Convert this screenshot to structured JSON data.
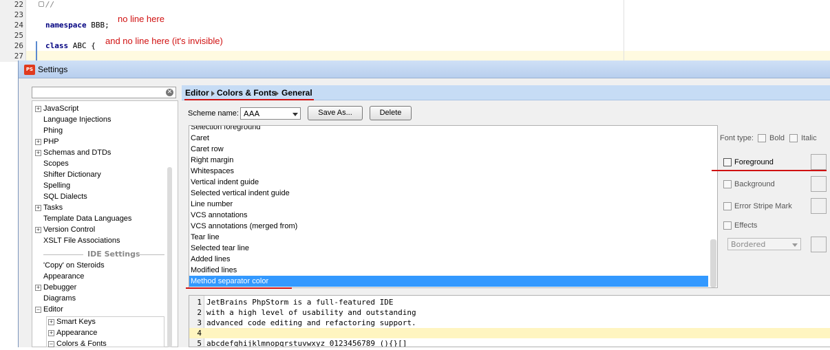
{
  "editor": {
    "line_numbers": [
      "22",
      "23",
      "24",
      "25",
      "26",
      "27"
    ],
    "line_comment": "//",
    "line_namespace_kw": "namespace",
    "line_namespace_rest": " BBB;",
    "line_class_kw": "class",
    "line_class_rest": " ABC {"
  },
  "annotations": {
    "note1": "no line here",
    "note2": "and no line here (it's invisible)"
  },
  "dialog": {
    "title": "Settings",
    "app_icon_text": "PS"
  },
  "search": {
    "value": "",
    "clear_glyph": "✕"
  },
  "tree": {
    "items": [
      {
        "label": "JavaScript",
        "expandable": true,
        "glyph": "+"
      },
      {
        "label": "Language Injections",
        "expandable": false
      },
      {
        "label": "Phing",
        "expandable": false
      },
      {
        "label": "PHP",
        "expandable": true,
        "glyph": "+"
      },
      {
        "label": "Schemas and DTDs",
        "expandable": true,
        "glyph": "+"
      },
      {
        "label": "Scopes",
        "expandable": false
      },
      {
        "label": "Shifter Dictionary",
        "expandable": false
      },
      {
        "label": "Spelling",
        "expandable": false
      },
      {
        "label": "SQL Dialects",
        "expandable": false
      },
      {
        "label": "Tasks",
        "expandable": true,
        "glyph": "+"
      },
      {
        "label": "Template Data Languages",
        "expandable": false
      },
      {
        "label": "Version Control",
        "expandable": true,
        "glyph": "+"
      },
      {
        "label": "XSLT File Associations",
        "expandable": false
      }
    ],
    "section_ide": "IDE Settings",
    "ide_items": [
      {
        "label": "'Copy' on Steroids",
        "expandable": false
      },
      {
        "label": "Appearance",
        "expandable": false
      },
      {
        "label": "Debugger",
        "expandable": true,
        "glyph": "+"
      },
      {
        "label": "Diagrams",
        "expandable": false
      },
      {
        "label": "Editor",
        "expandable": true,
        "glyph": "−"
      }
    ],
    "editor_children": [
      {
        "label": "Smart Keys",
        "glyph": "+"
      },
      {
        "label": "Appearance",
        "glyph": "+"
      },
      {
        "label": "Colors & Fonts",
        "glyph": "−"
      }
    ]
  },
  "breadcrumb": {
    "part1": "Editor",
    "part2": "Colors & Fonts",
    "part3": "General"
  },
  "scheme": {
    "label": "Scheme name:",
    "selected": "AAA",
    "save_as_label": "Save As...",
    "delete_label": "Delete"
  },
  "elements": {
    "items": [
      "Selection foreground",
      "Caret",
      "Caret row",
      "Right margin",
      "Whitespaces",
      "Vertical indent guide",
      "Selected vertical indent guide",
      "Line number",
      "VCS annotations",
      "VCS annotations (merged from)",
      "Tear line",
      "Selected tear line",
      "Added lines",
      "Modified lines",
      "Method separator color"
    ],
    "selected_index": 14
  },
  "attributes": {
    "font_type_label": "Font type:",
    "bold_label": "Bold",
    "italic_label": "Italic",
    "foreground_label": "Foreground",
    "background_label": "Background",
    "error_stripe_label": "Error Stripe Mark",
    "effects_label": "Effects",
    "effect_type": "Bordered"
  },
  "preview": {
    "lines": [
      {
        "num": "1",
        "text": "JetBrains PhpStorm is a full-featured IDE"
      },
      {
        "num": "2",
        "text": "with a high level of usability and outstanding"
      },
      {
        "num": "3",
        "text": "advanced code editing and refactoring support."
      },
      {
        "num": "4",
        "text": ""
      },
      {
        "num": "5",
        "text": "abcdefghijklmnopqrstuvwxyz 0123456789 (){}[]"
      }
    ],
    "current_line": 4
  },
  "colors": {
    "selection": "#3399ff",
    "annotation_red": "#d01010",
    "breadcrumb_bg": "#c6dcf5"
  }
}
